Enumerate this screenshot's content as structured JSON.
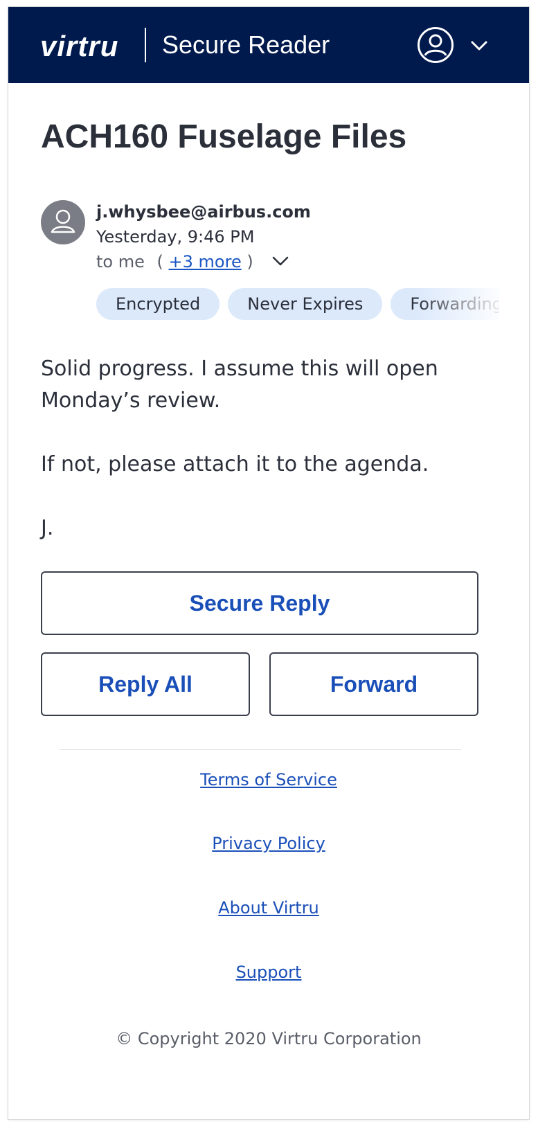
{
  "header": {
    "logo_text": "virtru",
    "app_title": "Secure Reader",
    "account_icon": "user-circle-icon",
    "menu_icon": "chevron-down-icon"
  },
  "message": {
    "subject": "ACH160 Fuselage Files",
    "sender_email": "j.whysbee@airbus.com",
    "timestamp": "Yesterday, 9:46 PM",
    "recipients_prefix": "to me",
    "recipients_open": "(",
    "recipients_more": "+3 more",
    "recipients_close": ")",
    "chips": [
      "Encrypted",
      "Never Expires",
      "Forwarding"
    ],
    "body": {
      "line1": "Solid progress. I assume this will open",
      "line2": "Monday’s review.",
      "line3": "If not, please attach it to the agenda.",
      "line4": "J."
    }
  },
  "actions": {
    "secure_reply": "Secure Reply",
    "reply_all": "Reply All",
    "forward": "Forward"
  },
  "footer": {
    "links": [
      "Terms of Service",
      "Privacy Policy",
      "About Virtru",
      "Support"
    ],
    "copyright": "© Copyright 2020 Virtru Corporation"
  },
  "colors": {
    "header_bg": "#001a4d",
    "accent": "#1a4fb8",
    "chip_bg": "#dce9fb"
  }
}
